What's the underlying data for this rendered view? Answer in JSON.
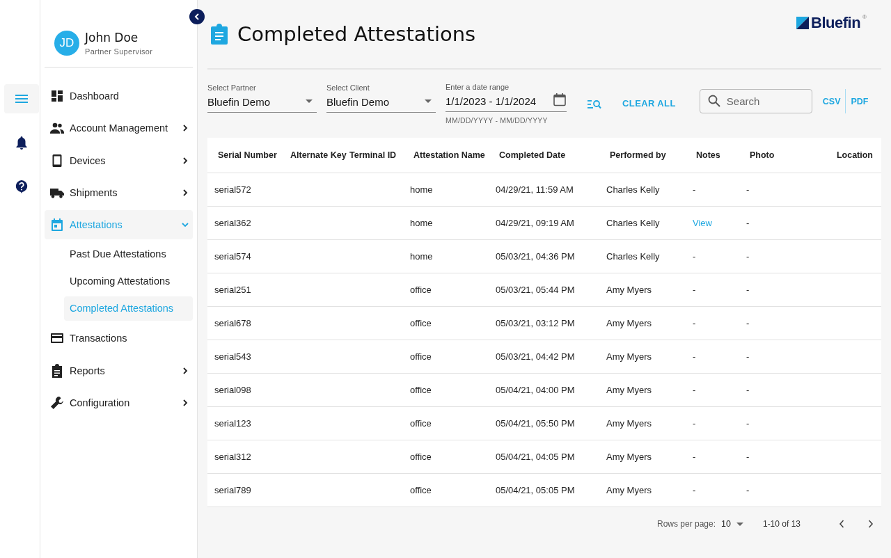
{
  "user": {
    "initials": "JD",
    "name": "John Doe",
    "role": "Partner Supervisor"
  },
  "nav": [
    {
      "label": "Dashboard",
      "expandable": false,
      "selected": false
    },
    {
      "label": "Account Management",
      "expandable": true,
      "expanded": false,
      "selected": false
    },
    {
      "label": "Devices",
      "expandable": true,
      "expanded": false,
      "selected": false
    },
    {
      "label": "Shipments",
      "expandable": true,
      "expanded": false,
      "selected": false
    },
    {
      "label": "Attestations",
      "expandable": true,
      "expanded": true,
      "selected": true,
      "children": [
        {
          "label": "Past Due Attestations",
          "selected": false
        },
        {
          "label": "Upcoming Attestations",
          "selected": false
        },
        {
          "label": "Completed Attestations",
          "selected": true
        }
      ]
    },
    {
      "label": "Transactions",
      "expandable": false,
      "selected": false
    },
    {
      "label": "Reports",
      "expandable": true,
      "expanded": false,
      "selected": false
    },
    {
      "label": "Configuration",
      "expandable": true,
      "expanded": false,
      "selected": false
    }
  ],
  "logo": {
    "text": "Bluefin",
    "mark": "®"
  },
  "page_title": "Completed Attestations",
  "filters": {
    "partner": {
      "label": "Select Partner",
      "value": "Bluefin Demo"
    },
    "client": {
      "label": "Select Client",
      "value": "Bluefin Demo"
    },
    "date_range": {
      "label": "Enter a date range",
      "value": "1/1/2023 - 1/1/2024",
      "hint": "MM/DD/YYYY - MM/DD/YYYY"
    },
    "clear_all": "CLEAR ALL",
    "search": {
      "placeholder": "Search"
    },
    "exports": [
      "CSV",
      "PDF"
    ]
  },
  "table": {
    "columns": [
      "Serial Number",
      "Alternate Key",
      "Terminal ID",
      "Attestation Name",
      "Completed Date",
      "Performed by",
      "Notes",
      "Photo",
      "Location"
    ],
    "rows": [
      {
        "serial": "serial572",
        "attestation": "home",
        "completed": "04/29/21, 11:59 AM",
        "performed_by": "Charles Kelly",
        "notes": {
          "text": "-",
          "link": false
        },
        "photo": "-"
      },
      {
        "serial": "serial362",
        "attestation": "home",
        "completed": "04/29/21, 09:19 AM",
        "performed_by": "Charles Kelly",
        "notes": {
          "text": "View",
          "link": true
        },
        "photo": "-"
      },
      {
        "serial": "serial574",
        "attestation": "home",
        "completed": "05/03/21, 04:36 PM",
        "performed_by": "Charles Kelly",
        "notes": {
          "text": "-",
          "link": false
        },
        "photo": "-"
      },
      {
        "serial": "serial251",
        "attestation": "office",
        "completed": "05/03/21, 05:44 PM",
        "performed_by": "Amy Myers",
        "notes": {
          "text": "-",
          "link": false
        },
        "photo": "-"
      },
      {
        "serial": "serial678",
        "attestation": "office",
        "completed": "05/03/21, 03:12 PM",
        "performed_by": "Amy Myers",
        "notes": {
          "text": "-",
          "link": false
        },
        "photo": "-"
      },
      {
        "serial": "serial543",
        "attestation": "office",
        "completed": "05/03/21, 04:42 PM",
        "performed_by": "Amy Myers",
        "notes": {
          "text": "-",
          "link": false
        },
        "photo": "-"
      },
      {
        "serial": "serial098",
        "attestation": "office",
        "completed": "05/04/21, 04:00 PM",
        "performed_by": "Amy Myers",
        "notes": {
          "text": "-",
          "link": false
        },
        "photo": "-"
      },
      {
        "serial": "serial123",
        "attestation": "office",
        "completed": "05/04/21, 05:50 PM",
        "performed_by": "Amy Myers",
        "notes": {
          "text": "-",
          "link": false
        },
        "photo": "-"
      },
      {
        "serial": "serial312",
        "attestation": "office",
        "completed": "05/04/21, 04:05 PM",
        "performed_by": "Amy Myers",
        "notes": {
          "text": "-",
          "link": false
        },
        "photo": "-"
      },
      {
        "serial": "serial789",
        "attestation": "office",
        "completed": "05/04/21, 05:05 PM",
        "performed_by": "Amy Myers",
        "notes": {
          "text": "-",
          "link": false
        },
        "photo": "-"
      }
    ]
  },
  "pagination": {
    "rows_label": "Rows per page:",
    "rows_value": "10",
    "range": "1-10 of 13"
  }
}
